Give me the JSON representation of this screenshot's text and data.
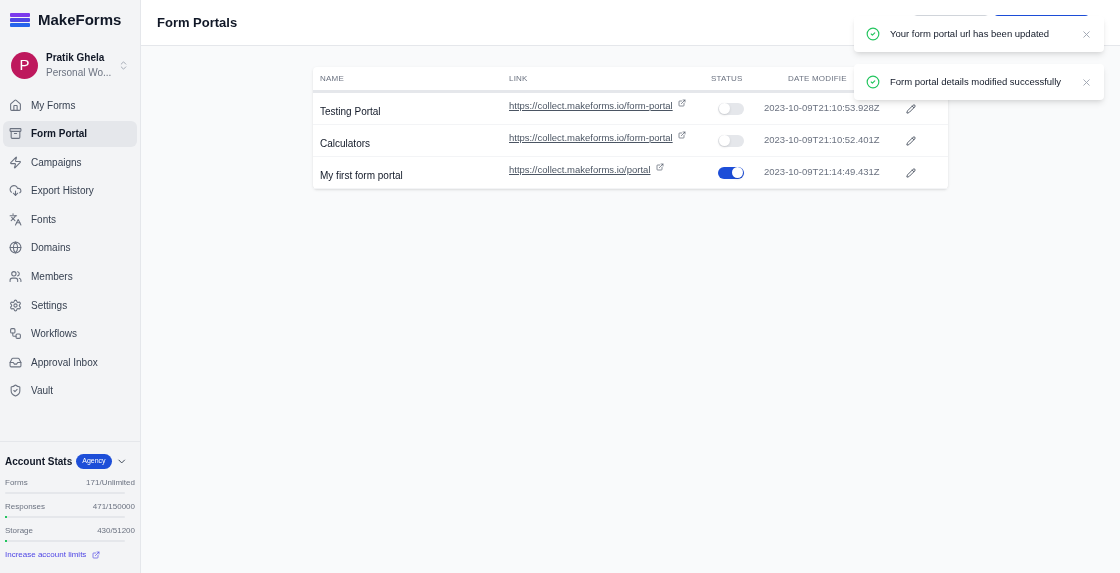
{
  "brand": {
    "name": "MakeForms"
  },
  "user": {
    "name": "Pratik Ghela",
    "workspace": "Personal Wo...",
    "initial": "P"
  },
  "sidebar": {
    "items": [
      {
        "label": "My Forms",
        "selected": false
      },
      {
        "label": "Form Portal",
        "selected": true
      },
      {
        "label": "Campaigns",
        "selected": false
      },
      {
        "label": "Export History",
        "selected": false
      },
      {
        "label": "Fonts",
        "selected": false
      },
      {
        "label": "Domains",
        "selected": false
      },
      {
        "label": "Members",
        "selected": false
      },
      {
        "label": "Settings",
        "selected": false
      },
      {
        "label": "Workflows",
        "selected": false
      },
      {
        "label": "Approval Inbox",
        "selected": false
      },
      {
        "label": "Vault",
        "selected": false
      }
    ]
  },
  "account_stats": {
    "title": "Account Stats",
    "badge": "Agency",
    "stats": [
      {
        "label": "Forms",
        "value": "171/Unlimited"
      },
      {
        "label": "Responses",
        "value": "471/150000",
        "level": 0.003
      },
      {
        "label": "Storage",
        "value": "430/51200",
        "level": 0.008
      }
    ],
    "link": "Increase account limits"
  },
  "header": {
    "title": "Form Portals"
  },
  "table": {
    "columns": [
      "NAME",
      "LINK",
      "STATUS",
      "DATE MODIFIE"
    ],
    "rows": [
      {
        "name": "Testing Portal",
        "link": "https://collect.makeforms.io/form-portal",
        "on": false,
        "date": "2023-10-09T21:10:53.928Z"
      },
      {
        "name": "Calculators",
        "link": "https://collect.makeforms.io/form-portal",
        "on": false,
        "date": "2023-10-09T21:10:52.401Z"
      },
      {
        "name": "My first form portal",
        "link": "https://collect.makeforms.io/portal",
        "on": true,
        "date": "2023-10-09T21:14:49.431Z"
      }
    ]
  },
  "toasts": [
    {
      "message": "Your form portal url has been updated"
    },
    {
      "message": "Form portal details modified successfully"
    }
  ]
}
